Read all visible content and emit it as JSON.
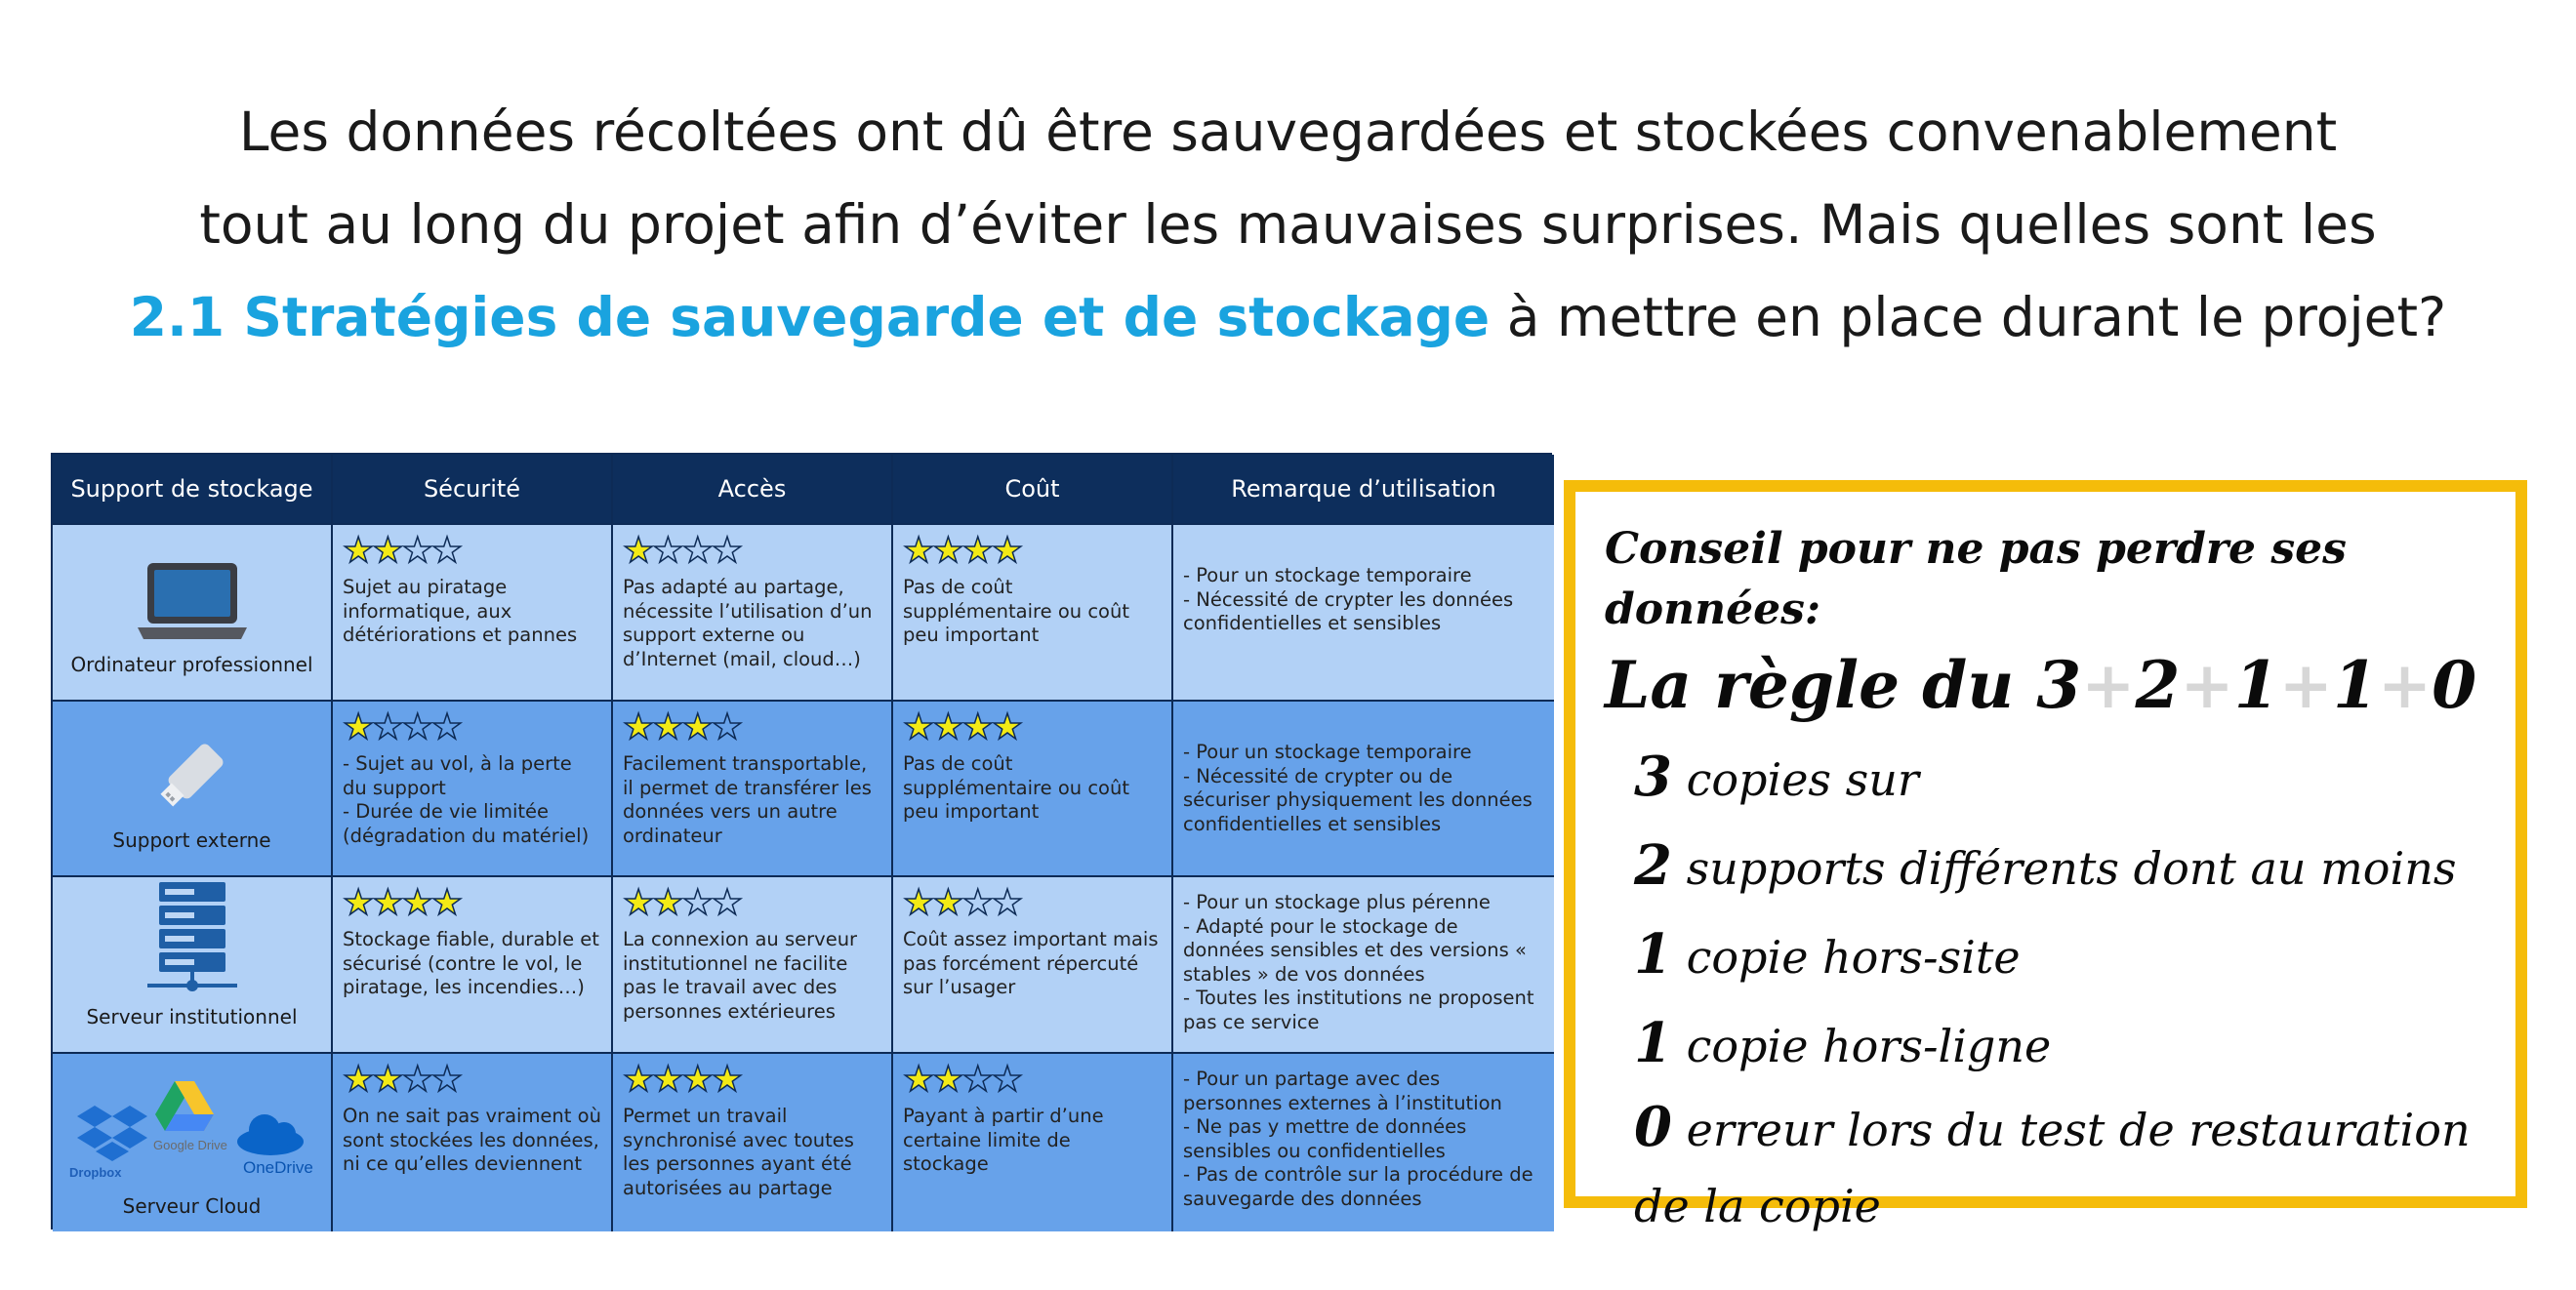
{
  "heading": {
    "line1": "Les données récoltées ont dû être sauvegardées et stockées convenablement",
    "line2": "tout au long du projet afin d’éviter les mauvaises surprises. Mais quelles sont les",
    "highlight": "2.1 Stratégies de sauvegarde et de stockage",
    "line3_rest": " à mettre en place durant le projet?",
    "highlight_color": "#1aa3df"
  },
  "table": {
    "headers": [
      "Support de stockage",
      "Sécurité",
      "Accès",
      "Coût",
      "Remarque d’utilisation"
    ],
    "rows": [
      {
        "support": "Ordinateur professionnel",
        "icon": "laptop-icon",
        "securite": {
          "stars": 2,
          "text": "Sujet au piratage informatique, aux détériorations et pannes"
        },
        "acces": {
          "stars": 1,
          "text": "Pas adapté au partage, nécessite l’utilisation d’un support externe ou d’Internet (mail, cloud…)"
        },
        "cout": {
          "stars": 4,
          "text": "Pas de coût supplémentaire ou coût peu important"
        },
        "remarque": "- Pour un stockage temporaire\n- Nécessité de crypter les données confidentielles et sensibles"
      },
      {
        "support": "Support externe",
        "icon": "usb-drive-icon",
        "securite": {
          "stars": 1,
          "text": "- Sujet au vol, à la perte du support\n- Durée de vie limitée (dégradation du matériel)"
        },
        "acces": {
          "stars": 3,
          "text": "Facilement transportable, il permet de transférer les données vers un autre ordinateur"
        },
        "cout": {
          "stars": 4,
          "text": "Pas de coût supplémentaire ou coût peu important"
        },
        "remarque": "- Pour un stockage temporaire\n- Nécessité de crypter ou de sécuriser physiquement les données confidentielles et sensibles"
      },
      {
        "support": "Serveur institutionnel",
        "icon": "server-icon",
        "securite": {
          "stars": 4,
          "text": "Stockage fiable, durable et sécurisé (contre le vol, le piratage, les incendies…)"
        },
        "acces": {
          "stars": 2,
          "text": "La connexion au serveur institutionnel ne facilite pas le travail avec des personnes extérieures"
        },
        "cout": {
          "stars": 2,
          "text": "Coût assez important mais pas forcément répercuté sur l’usager"
        },
        "remarque": "- Pour un stockage plus pérenne\n- Adapté pour le stockage de données sensibles et des versions « stables » de vos données\n- Toutes les institutions ne proposent pas ce service"
      },
      {
        "support": "Serveur Cloud",
        "icon": "cloud-services-icon",
        "cloud_logos": [
          "Dropbox",
          "Google Drive",
          "OneDrive"
        ],
        "securite": {
          "stars": 2,
          "text": "On ne sait pas vraiment où sont stockées les données, ni ce qu’elles deviennent"
        },
        "acces": {
          "stars": 4,
          "text": "Permet un travail synchronisé avec toutes les personnes ayant été autorisées au partage"
        },
        "cout": {
          "stars": 2,
          "text": "Payant à partir d’une certaine limite de stockage"
        },
        "remarque": "- Pour un partage avec des personnes externes à l’institution\n- Ne pas y mettre de données sensibles ou confidentielles\n- Pas de contrôle sur la procédure de sauvegarde des données"
      }
    ]
  },
  "tip": {
    "title": "Conseil pour ne pas perdre ses données:",
    "rule_prefix": "La règle du ",
    "rule_numbers": [
      "3",
      "2",
      "1",
      "1",
      "0"
    ],
    "plus": "+",
    "lines": [
      {
        "num": "3",
        "text": " copies sur"
      },
      {
        "num": "2",
        "text": " supports différents dont au moins"
      },
      {
        "num": "1",
        "text": " copie hors-site"
      },
      {
        "num": "1",
        "text": " copie hors-ligne"
      },
      {
        "num": "0",
        "text": " erreur lors du test de restauration de la copie"
      }
    ],
    "border_color": "#f5bc0a"
  }
}
